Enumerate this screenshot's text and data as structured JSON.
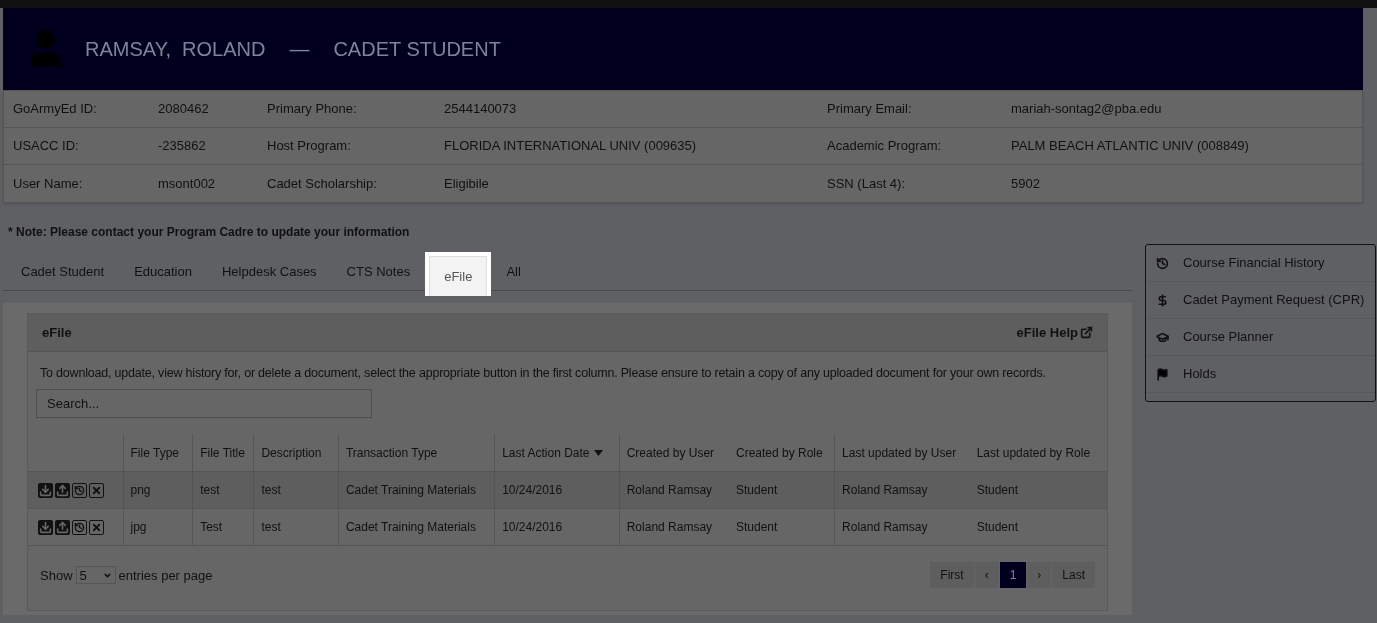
{
  "header": {
    "name": "RAMSAY,  ROLAND",
    "separator": "—",
    "role": "CADET STUDENT"
  },
  "info_rows": [
    [
      {
        "label": "GoArmyEd ID:",
        "value": "2080462"
      },
      {
        "label": "Primary Phone:",
        "value": "2544140073"
      },
      {
        "label": "Primary Email:",
        "value": "mariah-sontag2@pba.edu"
      }
    ],
    [
      {
        "label": "USACC ID:",
        "value": "-235862"
      },
      {
        "label": "Host Program:",
        "value": "FLORIDA INTERNATIONAL UNIV (009635)"
      },
      {
        "label": "Academic Program:",
        "value": "PALM BEACH ATLANTIC UNIV (008849)"
      }
    ],
    [
      {
        "label": "User Name:",
        "value": "msont002"
      },
      {
        "label": "Cadet Scholarship:",
        "value": "Eligibile"
      },
      {
        "label": "SSN (Last 4):",
        "value": "5902"
      }
    ]
  ],
  "note": "* Note: Please contact your Program Cadre to update your information",
  "tabs": [
    {
      "label": "Cadet Student",
      "selected": false
    },
    {
      "label": "Education",
      "selected": false
    },
    {
      "label": "Helpdesk Cases",
      "selected": false
    },
    {
      "label": "CTS Notes",
      "selected": false
    },
    {
      "label": "eFile",
      "selected": true
    },
    {
      "label": "All",
      "selected": false
    }
  ],
  "panel": {
    "title": "eFile",
    "help_link": "eFile Help",
    "instructions": "To download, update, view history for, or delete a document, select the appropriate button in the first column. Please ensure to retain a copy of any uploaded document for your own records.",
    "search": {
      "placeholder": "Search..."
    }
  },
  "table": {
    "columns": [
      "File Type",
      "File Title",
      "Description",
      "Transaction Type",
      "Last Action Date",
      "Created by User",
      "Created by Role",
      "Last updated by User",
      "Last updated by Role"
    ],
    "rows": [
      [
        "png",
        "test",
        "test",
        "Cadet Training Materials",
        "10/24/2016",
        "Roland Ramsay",
        "Student",
        "Roland Ramsay",
        "Student"
      ],
      [
        "jpg",
        "Test",
        "test",
        "Cadet Training Materials",
        "10/24/2016",
        "Roland Ramsay",
        "Student",
        "Roland Ramsay",
        "Student"
      ]
    ]
  },
  "page_size": {
    "before": "Show",
    "value": "5",
    "after": "entries per page"
  },
  "pagination": [
    {
      "label": "First",
      "selected": false
    },
    {
      "label": "‹",
      "selected": false
    },
    {
      "label": "1",
      "selected": true
    },
    {
      "label": "›",
      "selected": false
    },
    {
      "label": "Last",
      "selected": false
    }
  ],
  "sidebar": [
    {
      "label": "Course Financial History"
    },
    {
      "label": "Cadet Payment Request (CPR)"
    },
    {
      "label": "Course Planner"
    },
    {
      "label": "Holds"
    }
  ]
}
